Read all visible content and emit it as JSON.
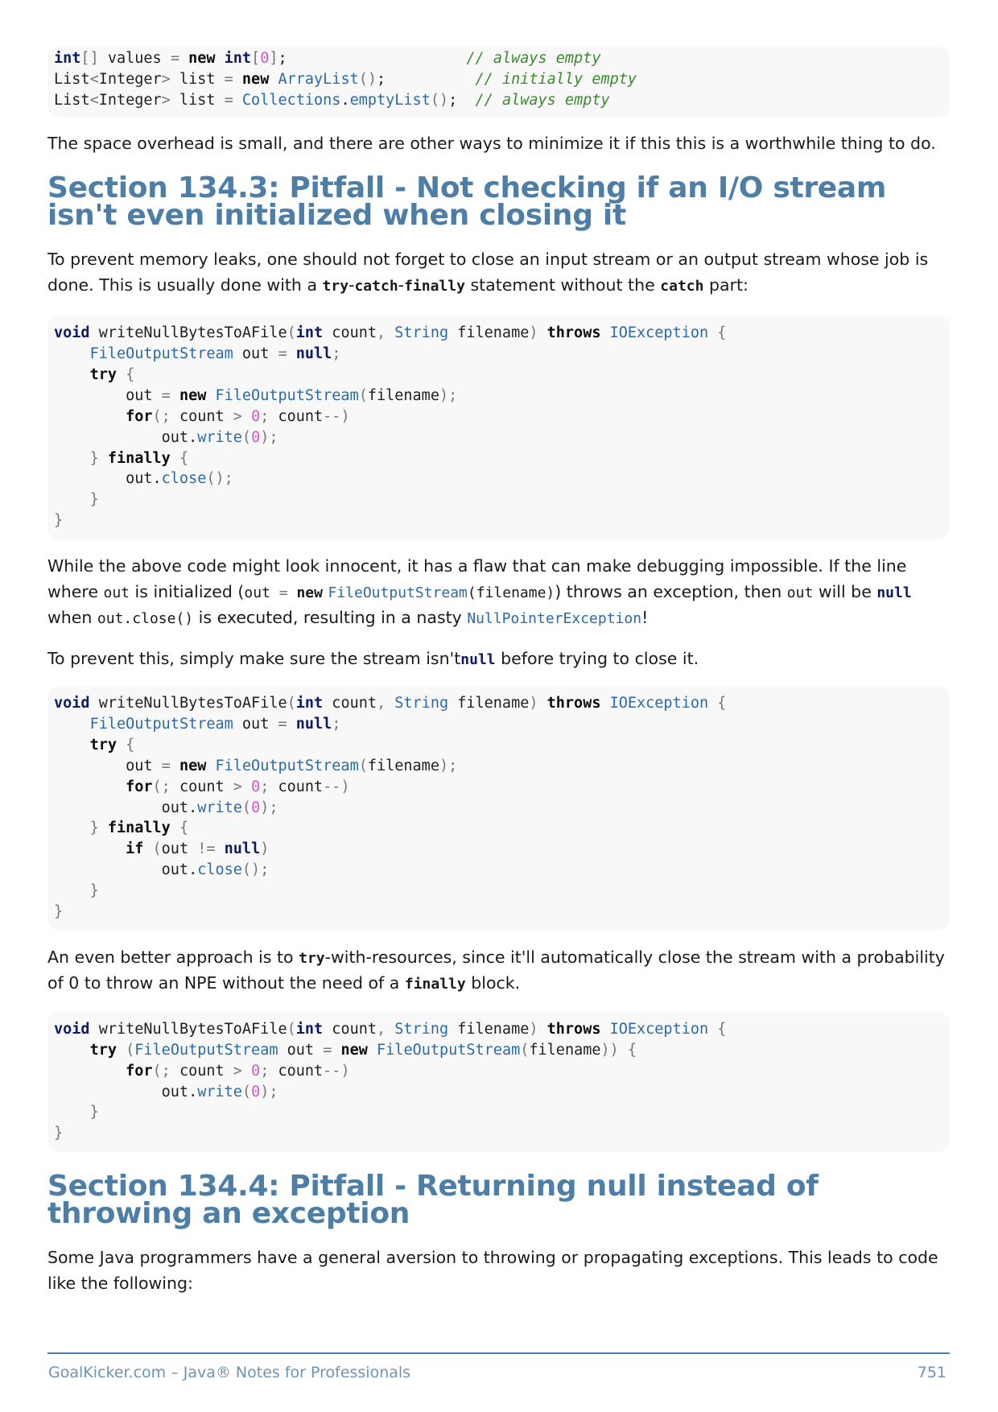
{
  "code_block_1": {
    "lines": [
      {
        "p1": "int",
        "p2": "[",
        "p3": "0",
        "p4": "] values = ",
        "p5": "new",
        "p6": "int",
        "p7": "[",
        "p8": "0",
        "p9": "];",
        "comment": "// always empty"
      },
      {
        "c": "List<Integer> list = new ArrayList();",
        "comment": "// initially empty"
      },
      {
        "c": "List<Integer> list = Collections.emptyList();",
        "comment": "// always empty"
      }
    ]
  },
  "para_space": "The space overhead is small, and there are other ways to minimize it if this this is a worthwhile thing to do.",
  "section_3_title": "Section 134.3: Pitfall - Not checking if an I/O stream isn't even initialized when closing it",
  "para_prevent_1": "To prevent memory leaks, one should not forget to close an input stream or an output stream whose job is done. This is usually done with a",
  "ic_try": "try",
  "ic_dash": "-",
  "ic_catch": "catch",
  "ic_finally": "finally",
  "para_prevent_1_mid": "statement without the",
  "para_prevent_1_end": "part:",
  "para_flaw": {
    "a": "While the above code might look innocent, it has a flaw that can make debugging impossible. If the line where",
    "out": "out",
    "b": "is initialized (",
    "init_code_out": "out",
    "init_code_eq": " = ",
    "init_code_new": "new",
    "init_code_type": "FileOutputStream",
    "init_code_args": "(filename)",
    "c": ") throws an exception, then",
    "d": "will be",
    "null": "null",
    "e": "when",
    "close_call": "out.close()",
    "f": "is executed, resulting in a nasty",
    "npe": "NullPointerException",
    "g": "!"
  },
  "para_null_check": {
    "a": "To prevent this, simply make sure the stream isn't",
    "null": "null",
    "b": "before trying to close it."
  },
  "para_better": {
    "a": "An even better approach is to",
    "try": "try",
    "b": "-with-resources, since it'll automatically close the stream with a probability of 0 to throw an NPE without the need of a",
    "finally": "finally",
    "c": "block."
  },
  "section_4_title": "Section 134.4: Pitfall - Returning null instead of throwing an exception",
  "para_aversion": "Some Java programmers have a general aversion to throwing or propagating exceptions. This leads to code like the following:",
  "footer": {
    "left": "GoalKicker.com – Java® Notes for Professionals",
    "page": "751"
  }
}
